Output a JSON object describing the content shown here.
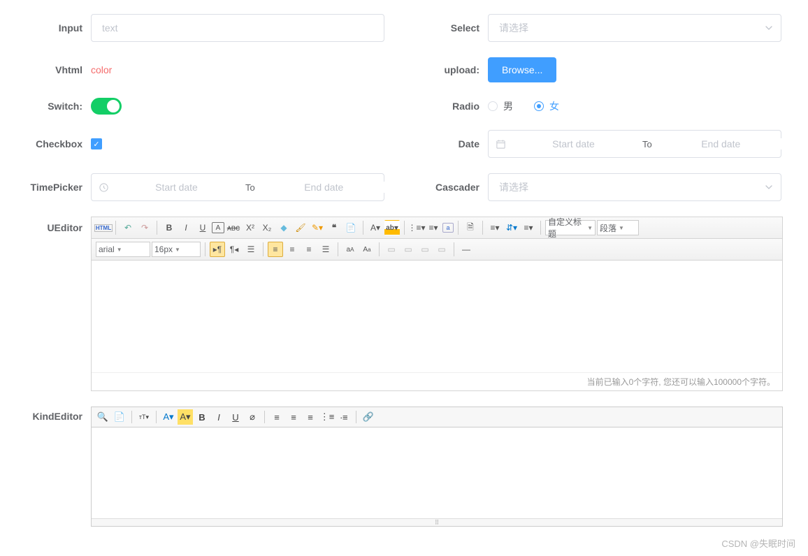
{
  "labels": {
    "input": "Input",
    "select": "Select",
    "vhtml": "Vhtml",
    "upload": "upload:",
    "switch": "Switch:",
    "radio": "Radio",
    "checkbox": "Checkbox",
    "date": "Date",
    "timepicker": "TimePicker",
    "cascader": "Cascader",
    "ueditor": "UEditor",
    "kindeditor": "KindEditor"
  },
  "input": {
    "placeholder": "text"
  },
  "select": {
    "placeholder": "请选择"
  },
  "vhtml": {
    "text": "color"
  },
  "upload": {
    "button": "Browse..."
  },
  "radio": {
    "options": [
      {
        "label": "男",
        "checked": false
      },
      {
        "label": "女",
        "checked": true
      }
    ]
  },
  "date": {
    "start_ph": "Start date",
    "end_ph": "End date",
    "sep": "To"
  },
  "timepicker": {
    "start_ph": "Start date",
    "end_ph": "End date",
    "sep": "To"
  },
  "cascader": {
    "placeholder": "请选择"
  },
  "ueditor": {
    "font_family": "arial",
    "font_size": "16px",
    "custom_title": "自定义标题",
    "paragraph": "段落",
    "status": "当前已输入0个字符, 您还可以输入100000个字符。",
    "tools_row1": [
      "html",
      "sep",
      "undo",
      "redo",
      "sep",
      "bold",
      "italic",
      "underline",
      "fontborder",
      "strike",
      "sup",
      "sub",
      "eraser",
      "format",
      "brush",
      "quote",
      "pre",
      "sep",
      "fontcolor",
      "bgcolor",
      "sep",
      "ol",
      "ul",
      "select",
      "sep",
      "snap",
      "sep",
      "al",
      "ac",
      "ar",
      "sep",
      "sep"
    ],
    "tools_row2": [
      "dir-ltr",
      "dir-rtl",
      "indent",
      "sep",
      "al2",
      "ac2",
      "ar2",
      "aj2",
      "sep",
      "tolower",
      "toupper",
      "sep",
      "img1",
      "img2",
      "img3",
      "img4",
      "sep",
      "hr"
    ]
  },
  "kindeditor": {
    "tools": [
      "source",
      "preview",
      "sep",
      "fontsize",
      "sep",
      "forecolor",
      "hilite",
      "bold",
      "italic",
      "underline",
      "remove",
      "sep",
      "jl",
      "jc",
      "jr",
      "ol",
      "ul",
      "sep",
      "link"
    ]
  },
  "watermark": "CSDN @失眠时间"
}
